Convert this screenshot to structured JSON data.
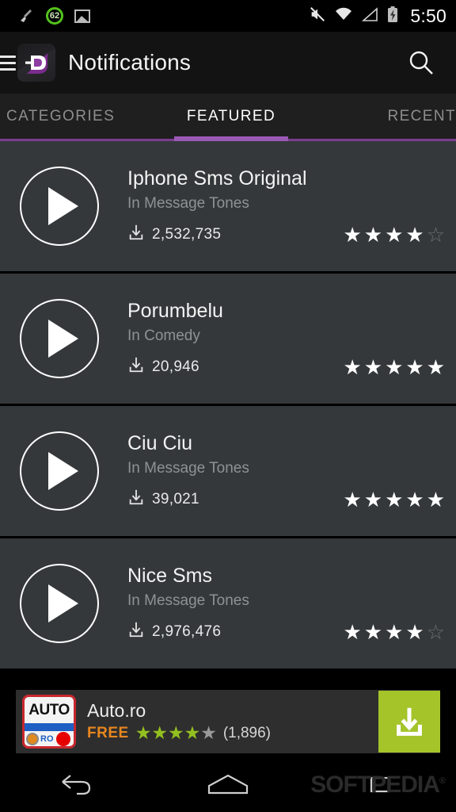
{
  "statusbar": {
    "icons": [
      "broom-icon",
      "cleaner-badge-62",
      "gallery-icon",
      "mute-icon",
      "wifi-icon",
      "signal-icon",
      "battery-charging-icon"
    ],
    "badge_value": "62",
    "time": "5:50"
  },
  "actionbar": {
    "menu_icon": "hamburger-icon",
    "logo_icon": "zedge-logo",
    "title": "Notifications",
    "search_icon": "search-icon"
  },
  "tabs": [
    {
      "label": "CATEGORIES",
      "active": false
    },
    {
      "label": "FEATURED",
      "active": true
    },
    {
      "label": "RECENT",
      "active": false
    }
  ],
  "accent_color": "#9b59b6",
  "list": [
    {
      "title": "Iphone Sms Original",
      "subtitle": "In Message Tones",
      "downloads": "2,532,735",
      "rating": 4,
      "max_rating": 5,
      "play_icon": "play-icon",
      "download_icon": "download-icon"
    },
    {
      "title": "Porumbelu",
      "subtitle": "In Comedy",
      "downloads": "20,946",
      "rating": 5,
      "max_rating": 5,
      "play_icon": "play-icon",
      "download_icon": "download-icon"
    },
    {
      "title": "Ciu Ciu",
      "subtitle": "In Message Tones",
      "downloads": "39,021",
      "rating": 5,
      "max_rating": 5,
      "play_icon": "play-icon",
      "download_icon": "download-icon"
    },
    {
      "title": "Nice Sms",
      "subtitle": "In Message Tones",
      "downloads": "2,976,476",
      "rating": 4,
      "max_rating": 5,
      "play_icon": "play-icon",
      "download_icon": "download-icon"
    }
  ],
  "ad": {
    "icon_label": "AUTO",
    "icon_sub_label": "RO",
    "title": "Auto.ro",
    "price_label": "FREE",
    "rating": 4,
    "max_rating": 5,
    "review_count": "(1,896)",
    "cta_icon": "download-icon",
    "cta_color": "#a4c42a",
    "price_color": "#e8861e",
    "star_color": "#93c01f"
  },
  "navbar": {
    "back_icon": "back-icon",
    "home_icon": "home-icon",
    "recents_icon": "recents-icon",
    "watermark": "SOFTPEDIA"
  }
}
